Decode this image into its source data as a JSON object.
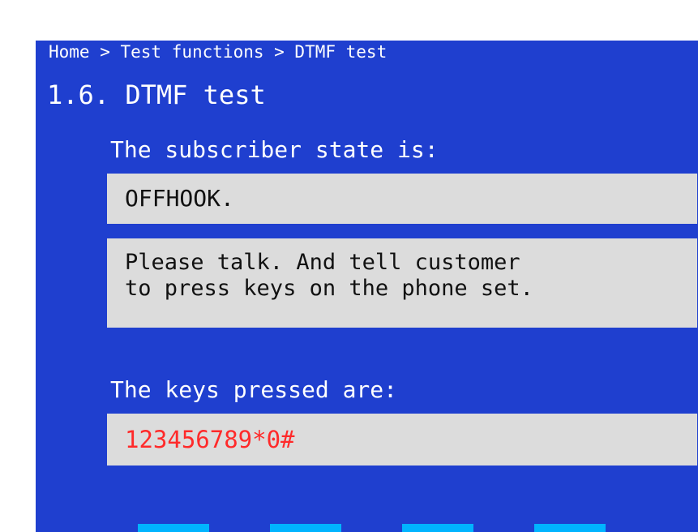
{
  "breadcrumb": "Home > Test functions > DTMF test",
  "page_title": "1.6. DTMF test",
  "subscriber": {
    "label": "The subscriber state is:",
    "state": "OFFHOOK."
  },
  "message": "Please talk. And tell customer\nto press keys on the phone set.",
  "keys": {
    "label": "The keys pressed are:",
    "value": "123456789*0#"
  },
  "colors": {
    "background": "#1f3fcf",
    "box": "#dcdcdc",
    "keys_text": "#ff2a2a",
    "softkey": "#00b4ff"
  },
  "softkeys": [
    {
      "label": ""
    },
    {
      "label": ""
    },
    {
      "label": ""
    },
    {
      "label": ""
    }
  ]
}
